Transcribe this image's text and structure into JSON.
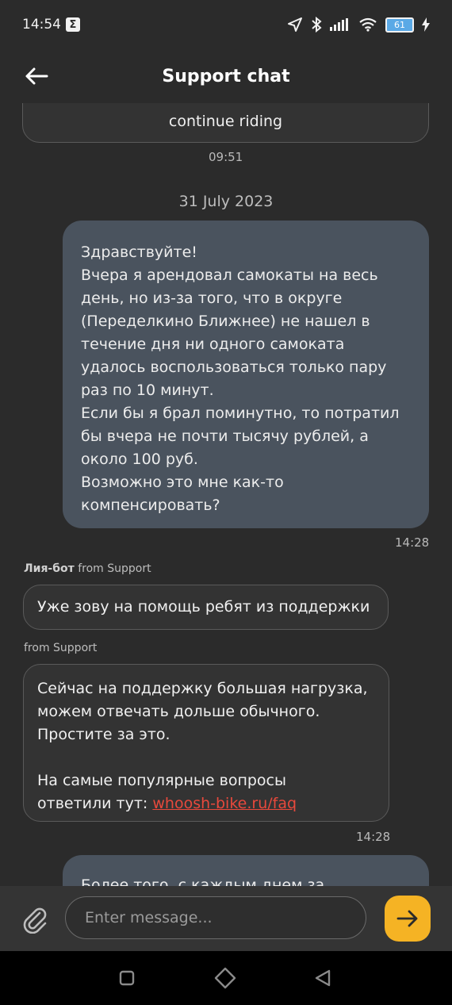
{
  "status": {
    "time": "14:54",
    "sigma": "Σ",
    "battery": "61"
  },
  "header": {
    "title": "Support chat"
  },
  "messages": {
    "prev_bubble_text": "continue riding",
    "prev_time": "09:51",
    "date_divider": "31 July 2023",
    "user_msg_lines": [
      "Здравствуйте!",
      "Вчера я арендовал самокаты на весь",
      "день, но из-за того, что в округе",
      "(Переделкино Ближнее) не нашел в",
      "течение дня ни одного самоката",
      "удалось воспользоваться только пару",
      "раз по 10 минут.",
      "Если бы я брал поминутно, то потратил",
      "бы вчера не почти тысячу рублей, а",
      "около 100 руб.",
      "Возможно это мне как-то",
      "компенсировать?"
    ],
    "user_msg_time": "14:28",
    "bot_sender_name": "Лия-бот",
    "bot_sender_suffix": "from Support",
    "bot_msg": "Уже зову на помощь ребят из поддержки",
    "support_sender": "from Support",
    "support_msg_lines": [
      "Сейчас на поддержку большая нагрузка,",
      "можем отвечать дольше обычного.",
      "Простите за это."
    ],
    "support_msg_line4": "На самые популярные вопросы",
    "support_msg_prefix": "ответили тут: ",
    "support_msg_link": "whoosh-bike.ru/faq",
    "support_msg_time": "14:28",
    "next_msg_partial": "Более того, с каждым днем за"
  },
  "composer": {
    "placeholder": "Enter message..."
  },
  "colors": {
    "accent": "#f5b324",
    "link": "#e8493c",
    "outgoing_bubble": "#4a535e"
  }
}
